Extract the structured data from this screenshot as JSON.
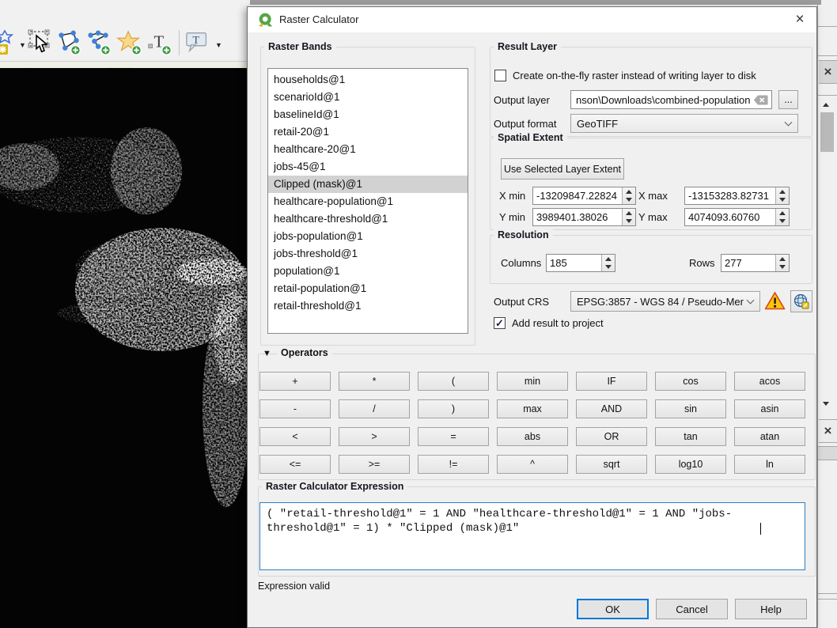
{
  "window": {
    "title": "Raster Calculator"
  },
  "icons": {
    "close": "×",
    "check": "✓",
    "collapse": "▼",
    "dropdown": "▼"
  },
  "toolbar": {
    "items": [
      "annotation-layer",
      "move-annotation",
      "polygon-annotation",
      "line-annotation",
      "marker-annotation",
      "text-annotation",
      "balloon-annotation"
    ]
  },
  "raster_bands": {
    "title": "Raster Bands",
    "selected_index": 6,
    "items": [
      "households@1",
      "scenarioId@1",
      "baselineId@1",
      "retail-20@1",
      "healthcare-20@1",
      "jobs-45@1",
      "Clipped (mask)@1",
      "healthcare-population@1",
      "healthcare-threshold@1",
      "jobs-population@1",
      "jobs-threshold@1",
      "population@1",
      "retail-population@1",
      "retail-threshold@1"
    ]
  },
  "result_layer": {
    "title": "Result Layer",
    "on_the_fly_label": "Create on-the-fly raster instead of writing layer to disk",
    "on_the_fly_checked": false,
    "output_layer_label": "Output layer",
    "output_layer_value": "nson\\Downloads\\combined-population",
    "browse_label": "...",
    "output_format_label": "Output format",
    "output_format_value": "GeoTIFF"
  },
  "spatial_extent": {
    "title": "Spatial Extent",
    "use_extent_button": "Use Selected Layer Extent",
    "x_min_label": "X min",
    "x_min": "-13209847.22824",
    "x_max_label": "X max",
    "x_max": "-13153283.82731",
    "y_min_label": "Y min",
    "y_min": "3989401.38026",
    "y_max_label": "Y max",
    "y_max": "4074093.60760"
  },
  "resolution": {
    "title": "Resolution",
    "columns_label": "Columns",
    "columns": "185",
    "rows_label": "Rows",
    "rows": "277"
  },
  "output_crs": {
    "label": "Output CRS",
    "value": "EPSG:3857 - WGS 84 / Pseudo-Mer"
  },
  "add_result": {
    "label": "Add result to project",
    "checked": true
  },
  "operators": {
    "title": "Operators",
    "rows": [
      [
        "+",
        "*",
        "(",
        "min",
        "IF",
        "cos",
        "acos"
      ],
      [
        "-",
        "/",
        ")",
        "max",
        "AND",
        "sin",
        "asin"
      ],
      [
        "<",
        ">",
        "=",
        "abs",
        "OR",
        "tan",
        "atan"
      ],
      [
        "<=",
        ">=",
        "!=",
        "^",
        "sqrt",
        "log10",
        "ln"
      ]
    ]
  },
  "expression": {
    "title": "Raster Calculator Expression",
    "value": "( \"retail-threshold@1\" = 1 AND \"healthcare-threshold@1\" = 1 AND \"jobs-threshold@1\" = 1) * \"Clipped (mask)@1\"",
    "status": "Expression valid"
  },
  "dialog_buttons": {
    "ok": "OK",
    "cancel": "Cancel",
    "help": "Help"
  },
  "colors": {
    "accent": "#0078d7",
    "qgis_green": "#589632",
    "warning": "#fdc30b",
    "selection_gray": "#d2d2d2"
  }
}
